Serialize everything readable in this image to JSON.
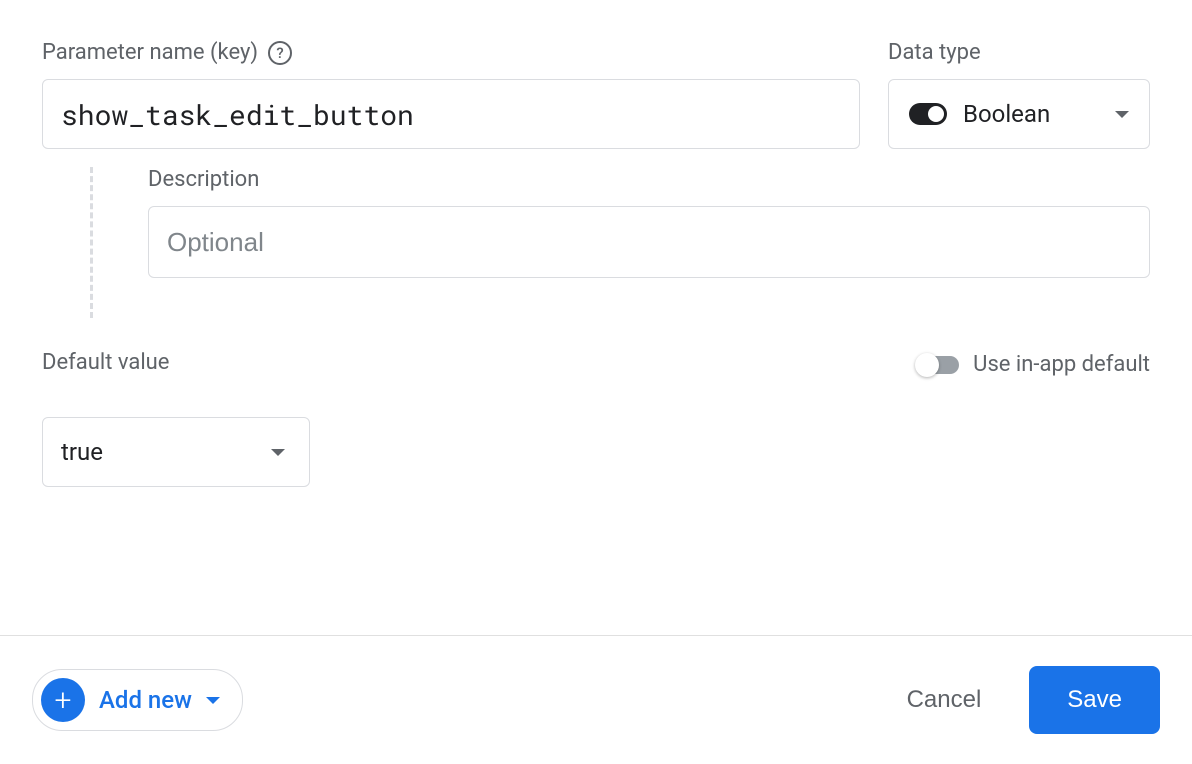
{
  "parameter": {
    "name_label": "Parameter name (key)",
    "name_value": "show_task_edit_button"
  },
  "data_type": {
    "label": "Data type",
    "selected": "Boolean"
  },
  "description": {
    "label": "Description",
    "placeholder": "Optional",
    "value": ""
  },
  "default_value": {
    "label": "Default value",
    "selected": "true"
  },
  "in_app_default": {
    "label": "Use in-app default",
    "enabled": false
  },
  "footer": {
    "add_new": "Add new",
    "cancel": "Cancel",
    "save": "Save"
  }
}
